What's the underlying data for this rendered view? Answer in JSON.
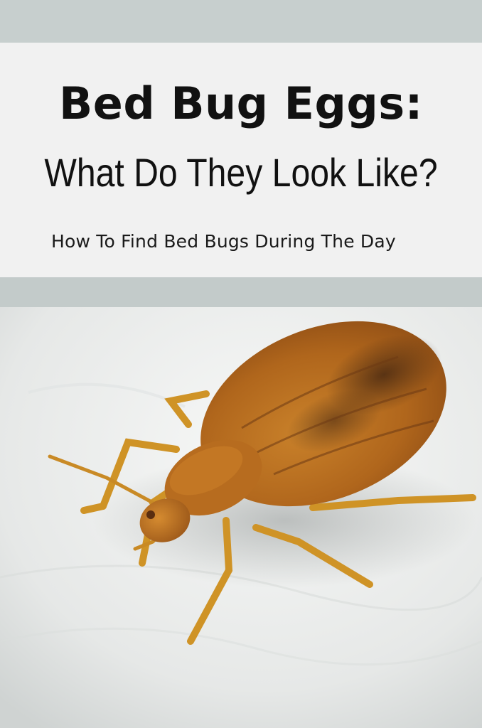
{
  "title": {
    "line1": "Bed Bug Eggs:",
    "line2": "What Do They Look Like?"
  },
  "subtitle": "How To Find Bed Bugs During The Day",
  "colors": {
    "top_band": "#c7cfce",
    "title_panel": "#f1f1f1",
    "mid_band": "#c3cbca",
    "text": "#111111",
    "bug_body": "#c27a22",
    "bug_dark": "#6a3b16",
    "bug_leg": "#d39a2b",
    "fabric": "#eceeed"
  },
  "image": {
    "subject": "bed-bug-photo"
  }
}
